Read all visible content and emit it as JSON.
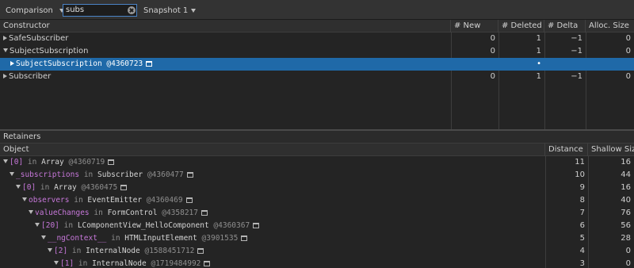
{
  "toolbar": {
    "view_mode": "Comparison",
    "search_value": "subs",
    "snapshot": "Snapshot 1"
  },
  "constructors": {
    "columns": [
      "Constructor",
      "# New",
      "# Deleted",
      "# Delta",
      "Alloc. Size"
    ],
    "rows": [
      {
        "name": "SafeSubscriber",
        "new": "0",
        "deleted": "1",
        "delta": "−1",
        "alloc": "0",
        "expanded": false
      },
      {
        "name": "SubjectSubscription",
        "new": "0",
        "deleted": "1",
        "delta": "−1",
        "alloc": "0",
        "expanded": true
      },
      {
        "name": "SubjectSubscription",
        "id": "@4360723",
        "new": "",
        "deleted": "•",
        "delta": "",
        "alloc": "",
        "selected": true
      },
      {
        "name": "Subscriber",
        "new": "0",
        "deleted": "1",
        "delta": "−1",
        "alloc": "0",
        "expanded": false
      }
    ]
  },
  "retainers": {
    "title": "Retainers",
    "columns": [
      "Object",
      "Distance",
      "Shallow Size"
    ],
    "rows": [
      {
        "prop": "[0]",
        "in": "in",
        "cls": "Array",
        "id": "@4360719",
        "distance": "11",
        "shallow": "16"
      },
      {
        "prop": "_subscriptions",
        "in": "in",
        "cls": "Subscriber",
        "id": "@4360477",
        "distance": "10",
        "shallow": "44"
      },
      {
        "prop": "[0]",
        "in": "in",
        "cls": "Array",
        "id": "@4360475",
        "distance": "9",
        "shallow": "16"
      },
      {
        "prop": "observers",
        "in": "in",
        "cls": "EventEmitter",
        "id": "@4360469",
        "distance": "8",
        "shallow": "40"
      },
      {
        "prop": "valueChanges",
        "in": "in",
        "cls": "FormControl",
        "id": "@4358217",
        "distance": "7",
        "shallow": "76"
      },
      {
        "prop": "[20]",
        "in": "in",
        "cls": "LComponentView_HelloComponent",
        "id": "@4360367",
        "distance": "6",
        "shallow": "56"
      },
      {
        "prop": "__ngContext__",
        "in": "in",
        "cls": "HTMLInputElement",
        "id": "@3901535",
        "distance": "5",
        "shallow": "28"
      },
      {
        "prop": "[2]",
        "in": "in",
        "cls": "InternalNode",
        "id": "@1588451712",
        "distance": "4",
        "shallow": "0"
      },
      {
        "prop": "[1]",
        "in": "in",
        "cls": "InternalNode",
        "id": "@1719484992",
        "distance": "3",
        "shallow": "0"
      }
    ]
  }
}
